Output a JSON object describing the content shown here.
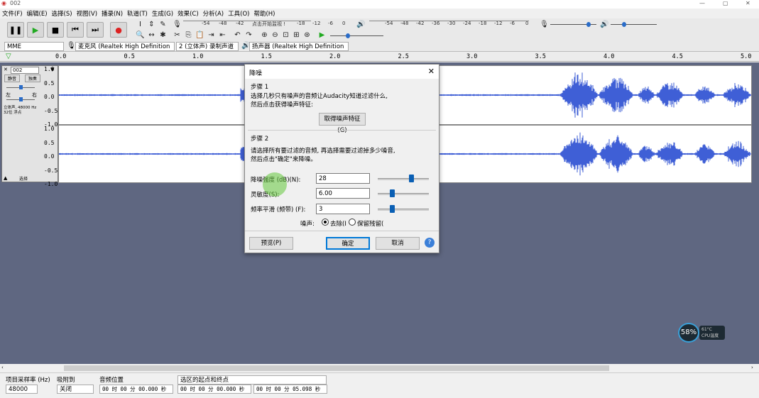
{
  "window": {
    "title": "002"
  },
  "menu": [
    "文件(F)",
    "编辑(E)",
    "选择(S)",
    "视图(V)",
    "播录(N)",
    "轨道(T)",
    "生成(G)",
    "效果(C)",
    "分析(A)",
    "工具(O)",
    "帮助(H)"
  ],
  "meter": {
    "rec_hint": "点击开始监视 !",
    "scale_left": [
      "-54",
      "-48",
      "-42",
      "-18",
      "-12",
      "-6",
      "0"
    ],
    "scale_right": [
      "-54",
      "-48",
      "-42",
      "-36",
      "-30",
      "-24",
      "-18",
      "-12",
      "-6",
      "0"
    ]
  },
  "device": {
    "host": "MME",
    "mic": "麦克风 (Realtek High Definition",
    "channels": "2 (立体声) 录制声道",
    "speaker": "扬声器 (Realtek High Definition"
  },
  "ruler": [
    "0.0",
    "0.5",
    "1.0",
    "1.5",
    "2.0",
    "2.5",
    "3.0",
    "3.5",
    "4.0",
    "4.5",
    "5.0"
  ],
  "track": {
    "name": "002",
    "mute": "静音",
    "solo": "独奏",
    "left": "左",
    "right": "右",
    "info": "立体声, 48000 Hz\n32位 浮点",
    "select": "选择",
    "yaxis": [
      "1.0",
      "0.5",
      "0.0",
      "-0.5",
      "-1.0"
    ]
  },
  "dialog": {
    "title": "降噪",
    "step1_label": "步骤 1",
    "step1_text": "选择几秒只有噪声的音频让Audacity知道过滤什么,",
    "step1_text2": "然后点击获得噪声特征:",
    "get_profile": "取得噪声特征(G)",
    "step2_label": "步骤 2",
    "step2_text": "请选择所有要过滤的音频, 再选择需要过滤掉多少噪音,",
    "step2_text2": "然后点击\"确定\"来降噪。",
    "noise_reduction_label": "降噪强度 (dB)(N):",
    "noise_reduction_value": "28",
    "noise_reduction_level": 0.65,
    "sensitivity_label": "灵敏度(S):",
    "sensitivity_value": "6.00",
    "sensitivity_level": 0.25,
    "smoothing_label": "频率平滑 (频带) (F):",
    "smoothing_value": "3",
    "smoothing_level": 0.25,
    "noise_label": "噪声:",
    "remove": "去除(I",
    "residue": "保留残留(",
    "preview": "预览(P)",
    "ok": "确定",
    "cancel": "取消"
  },
  "bottom": {
    "rate_label": "项目采样率 (Hz)",
    "rate_value": "48000",
    "snap_label": "吸附到",
    "snap_value": "关闭",
    "pos_label": "音频位置",
    "pos_value": "00 时 00 分 00.000 秒",
    "sel_label": "选区的起点和终点",
    "sel_start": "00 时 00 分 00.000 秒",
    "sel_end": "00 时 00 分 05.098 秒"
  },
  "cpu": {
    "percent": "58%",
    "temp": "61°C",
    "label": "CPU温度"
  },
  "colors": {
    "wave": "#3f5fd6",
    "track_bg": "#5f6781",
    "thumb": "#0a5fb4"
  }
}
